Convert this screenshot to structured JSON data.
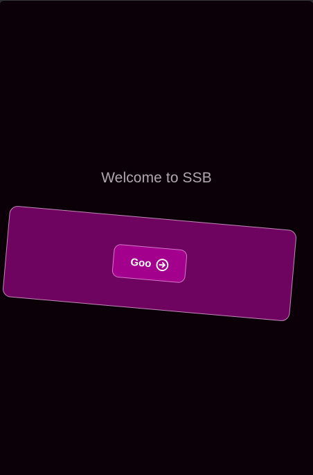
{
  "main": {
    "welcome_text": "Welcome to SSB",
    "go_button": {
      "label": "Goo",
      "icon": "arrow-right-circle-icon"
    }
  },
  "colors": {
    "background": "#0b0008",
    "card": "#6f0460",
    "button": "#a4008e",
    "text": "#b3a6ad"
  }
}
